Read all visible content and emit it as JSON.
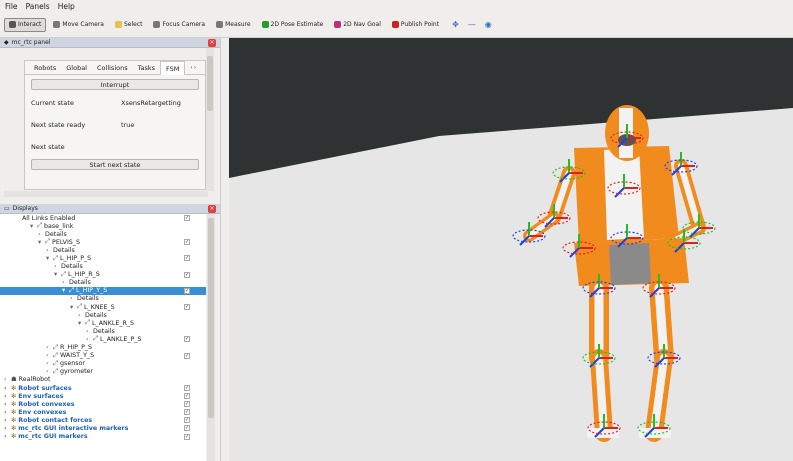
{
  "menu": [
    "File",
    "Panels",
    "Help"
  ],
  "toolbar": [
    {
      "label": "Interact",
      "icon": "interact-icon",
      "active": true
    },
    {
      "label": "Move Camera",
      "icon": "move-camera-icon"
    },
    {
      "label": "Select",
      "icon": "select-icon"
    },
    {
      "label": "Focus Camera",
      "icon": "focus-camera-icon"
    },
    {
      "label": "Measure",
      "icon": "measure-icon"
    },
    {
      "label": "2D Pose Estimate",
      "icon": "pose-estimate-icon"
    },
    {
      "label": "2D Nav Goal",
      "icon": "nav-goal-icon"
    },
    {
      "label": "Publish Point",
      "icon": "publish-point-icon"
    }
  ],
  "mc_panel": {
    "title": "mc_rtc panel",
    "tabs": [
      "Robots",
      "Global",
      "Collisions",
      "Tasks",
      "FSM"
    ],
    "selected_tab": "FSM",
    "interrupt_label": "Interrupt",
    "current_state_label": "Current state",
    "current_state_value": "XsensRetargetting",
    "next_ready_label": "Next state ready",
    "next_ready_value": "true",
    "next_state_label": "Next state",
    "start_next_label": "Start next state"
  },
  "displays": {
    "title": "Displays",
    "items": [
      {
        "label": "All Links Enabled",
        "indent": 22,
        "check": true
      },
      {
        "label": "base_link",
        "indent": 30,
        "arrow": "▾",
        "link": true
      },
      {
        "label": "Details",
        "indent": 38,
        "arrow": "›"
      },
      {
        "label": "PELVIS_S",
        "indent": 38,
        "arrow": "▾",
        "link": true,
        "check": true
      },
      {
        "label": "Details",
        "indent": 46,
        "arrow": "›"
      },
      {
        "label": "L_HIP_P_S",
        "indent": 46,
        "arrow": "▾",
        "link": true,
        "check": true
      },
      {
        "label": "Details",
        "indent": 54,
        "arrow": "›"
      },
      {
        "label": "L_HIP_R_S",
        "indent": 54,
        "arrow": "▾",
        "link": true,
        "check": true
      },
      {
        "label": "Details",
        "indent": 62,
        "arrow": "›"
      },
      {
        "label": "L_HIP_Y_S",
        "indent": 62,
        "arrow": "▾",
        "link": true,
        "check": true,
        "sel": true
      },
      {
        "label": "Details",
        "indent": 70,
        "arrow": "›"
      },
      {
        "label": "L_KNEE_S",
        "indent": 70,
        "arrow": "▾",
        "link": true,
        "check": true
      },
      {
        "label": "Details",
        "indent": 78,
        "arrow": "›"
      },
      {
        "label": "L_ANKLE_R_S",
        "indent": 78,
        "arrow": "▾",
        "link": true
      },
      {
        "label": "Details",
        "indent": 86,
        "arrow": "›"
      },
      {
        "label": "L_ANKLE_P_S",
        "indent": 86,
        "arrow": "›",
        "link": true,
        "check": true
      },
      {
        "label": "R_HIP_P_S",
        "indent": 46,
        "arrow": "›",
        "link": true
      },
      {
        "label": "WAIST_Y_S",
        "indent": 46,
        "arrow": "›",
        "link": true,
        "check": true
      },
      {
        "label": "gsensor",
        "indent": 46,
        "arrow": "›",
        "link": true
      },
      {
        "label": "gyrometer",
        "indent": 46,
        "arrow": "›",
        "link": true
      },
      {
        "label": "RealRobot",
        "indent": 4,
        "arrow": "›",
        "robot": true
      },
      {
        "label": "Robot surfaces",
        "indent": 4,
        "arrow": "›",
        "blue": true,
        "check": true
      },
      {
        "label": "Env surfaces",
        "indent": 4,
        "arrow": "›",
        "blue": true,
        "check": true
      },
      {
        "label": "Robot convexes",
        "indent": 4,
        "arrow": "›",
        "blue": true,
        "check": true
      },
      {
        "label": "Env convexes",
        "indent": 4,
        "arrow": "›",
        "blue": true,
        "check": true
      },
      {
        "label": "Robot contact forces",
        "indent": 4,
        "arrow": "›",
        "blue": true,
        "check": true
      },
      {
        "label": "mc_rtc GUI interactive markers",
        "indent": 4,
        "arrow": "›",
        "blue": true,
        "check": true
      },
      {
        "label": "mc_rtc GUI markers",
        "indent": 4,
        "arrow": "›",
        "blue": true,
        "check": true
      }
    ]
  },
  "colors": {
    "viewport_bg": "#2f3232",
    "floor": "#e6e6e6",
    "robot_orange": "#f28b1e",
    "robot_white": "#f2f2f2",
    "robot_grey": "#8a8a8a",
    "selection": "#3a8fd4"
  }
}
